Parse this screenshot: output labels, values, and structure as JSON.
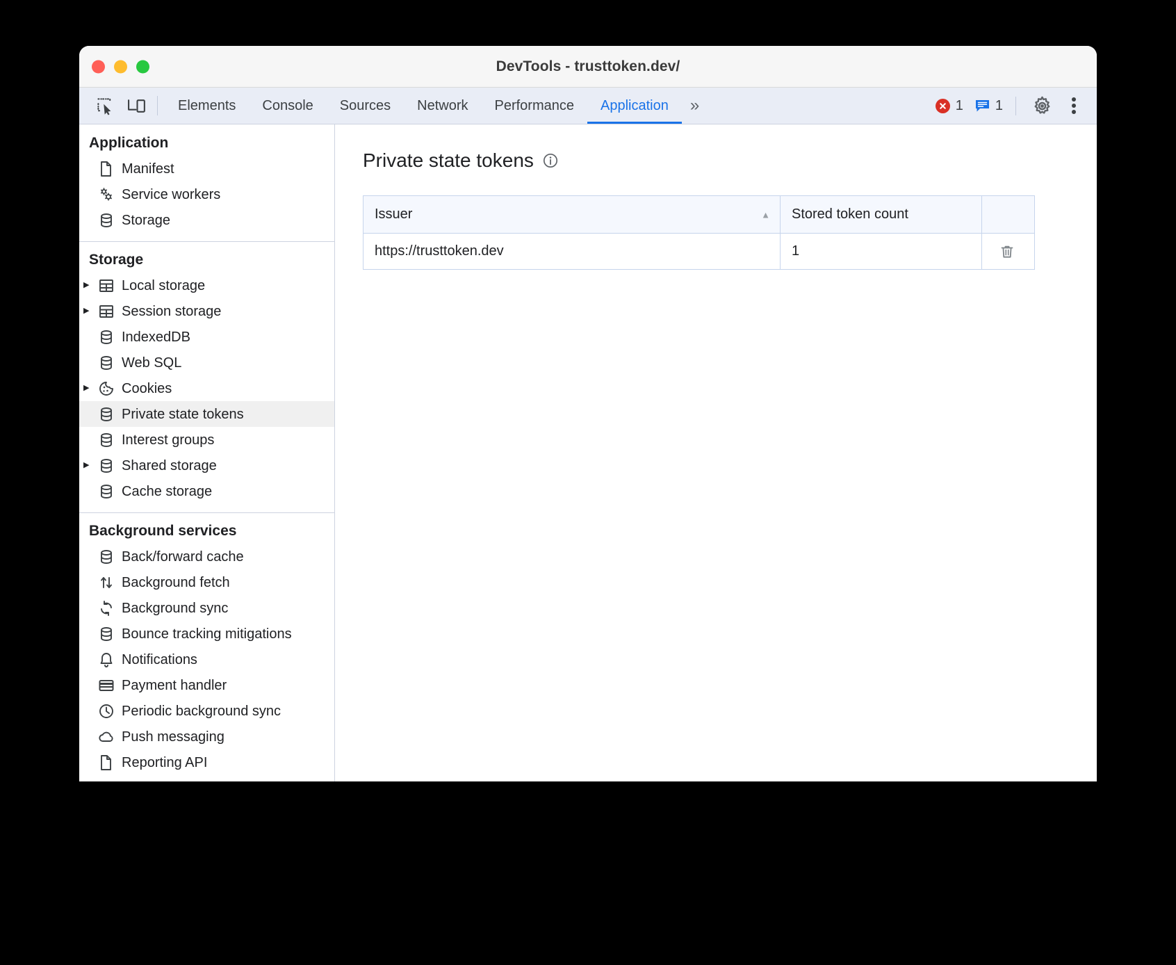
{
  "window": {
    "title": "DevTools - trusttoken.dev/",
    "traffic_lights": [
      "close",
      "minimize",
      "maximize"
    ],
    "colors": {
      "close": "#ff5f57",
      "minimize": "#febc2e",
      "maximize": "#28c840",
      "accent": "#1a73e8",
      "error": "#d93025",
      "message": "#1a73e8"
    }
  },
  "tabbar": {
    "left_icons": [
      {
        "name": "inspect-element-icon"
      },
      {
        "name": "device-toolbar-icon"
      }
    ],
    "tabs": [
      {
        "label": "Elements",
        "selected": false
      },
      {
        "label": "Console",
        "selected": false
      },
      {
        "label": "Sources",
        "selected": false
      },
      {
        "label": "Network",
        "selected": false
      },
      {
        "label": "Performance",
        "selected": false
      },
      {
        "label": "Application",
        "selected": true
      }
    ],
    "more_tabs_label": "»",
    "status": {
      "errors_count": "1",
      "messages_count": "1"
    },
    "right_icons": [
      {
        "name": "settings-gear-icon"
      },
      {
        "name": "more-options-kebab-icon"
      }
    ]
  },
  "sidebar": {
    "sections": [
      {
        "title": "Application",
        "items": [
          {
            "label": "Manifest",
            "icon": "document-icon",
            "expandable": false,
            "selected": false
          },
          {
            "label": "Service workers",
            "icon": "gears-icon",
            "expandable": false,
            "selected": false
          },
          {
            "label": "Storage",
            "icon": "database-icon",
            "expandable": false,
            "selected": false
          }
        ]
      },
      {
        "title": "Storage",
        "items": [
          {
            "label": "Local storage",
            "icon": "table-icon",
            "expandable": true,
            "selected": false
          },
          {
            "label": "Session storage",
            "icon": "table-icon",
            "expandable": true,
            "selected": false
          },
          {
            "label": "IndexedDB",
            "icon": "database-icon",
            "expandable": false,
            "selected": false
          },
          {
            "label": "Web SQL",
            "icon": "database-icon",
            "expandable": false,
            "selected": false
          },
          {
            "label": "Cookies",
            "icon": "cookie-icon",
            "expandable": true,
            "selected": false
          },
          {
            "label": "Private state tokens",
            "icon": "database-icon",
            "expandable": false,
            "selected": true
          },
          {
            "label": "Interest groups",
            "icon": "database-icon",
            "expandable": false,
            "selected": false
          },
          {
            "label": "Shared storage",
            "icon": "database-icon",
            "expandable": true,
            "selected": false
          },
          {
            "label": "Cache storage",
            "icon": "database-icon",
            "expandable": false,
            "selected": false
          }
        ]
      },
      {
        "title": "Background services",
        "items": [
          {
            "label": "Back/forward cache",
            "icon": "database-icon",
            "expandable": false,
            "selected": false
          },
          {
            "label": "Background fetch",
            "icon": "arrows-up-down-icon",
            "expandable": false,
            "selected": false
          },
          {
            "label": "Background sync",
            "icon": "sync-icon",
            "expandable": false,
            "selected": false
          },
          {
            "label": "Bounce tracking mitigations",
            "icon": "database-icon",
            "expandable": false,
            "selected": false
          },
          {
            "label": "Notifications",
            "icon": "bell-icon",
            "expandable": false,
            "selected": false
          },
          {
            "label": "Payment handler",
            "icon": "credit-card-icon",
            "expandable": false,
            "selected": false
          },
          {
            "label": "Periodic background sync",
            "icon": "clock-icon",
            "expandable": false,
            "selected": false
          },
          {
            "label": "Push messaging",
            "icon": "cloud-icon",
            "expandable": false,
            "selected": false
          },
          {
            "label": "Reporting API",
            "icon": "document-icon",
            "expandable": false,
            "selected": false
          }
        ]
      }
    ]
  },
  "main": {
    "title": "Private state tokens",
    "info_icon": "info-circle-icon",
    "table": {
      "columns": [
        {
          "label": "Issuer",
          "sorted": true,
          "sort_direction": "asc"
        },
        {
          "label": "Stored token count",
          "sorted": false
        },
        {
          "label": "",
          "sorted": false
        }
      ],
      "rows": [
        {
          "issuer": "https://trusttoken.dev",
          "stored_token_count": "1",
          "action_icon": "trash-delete-icon"
        }
      ]
    }
  }
}
